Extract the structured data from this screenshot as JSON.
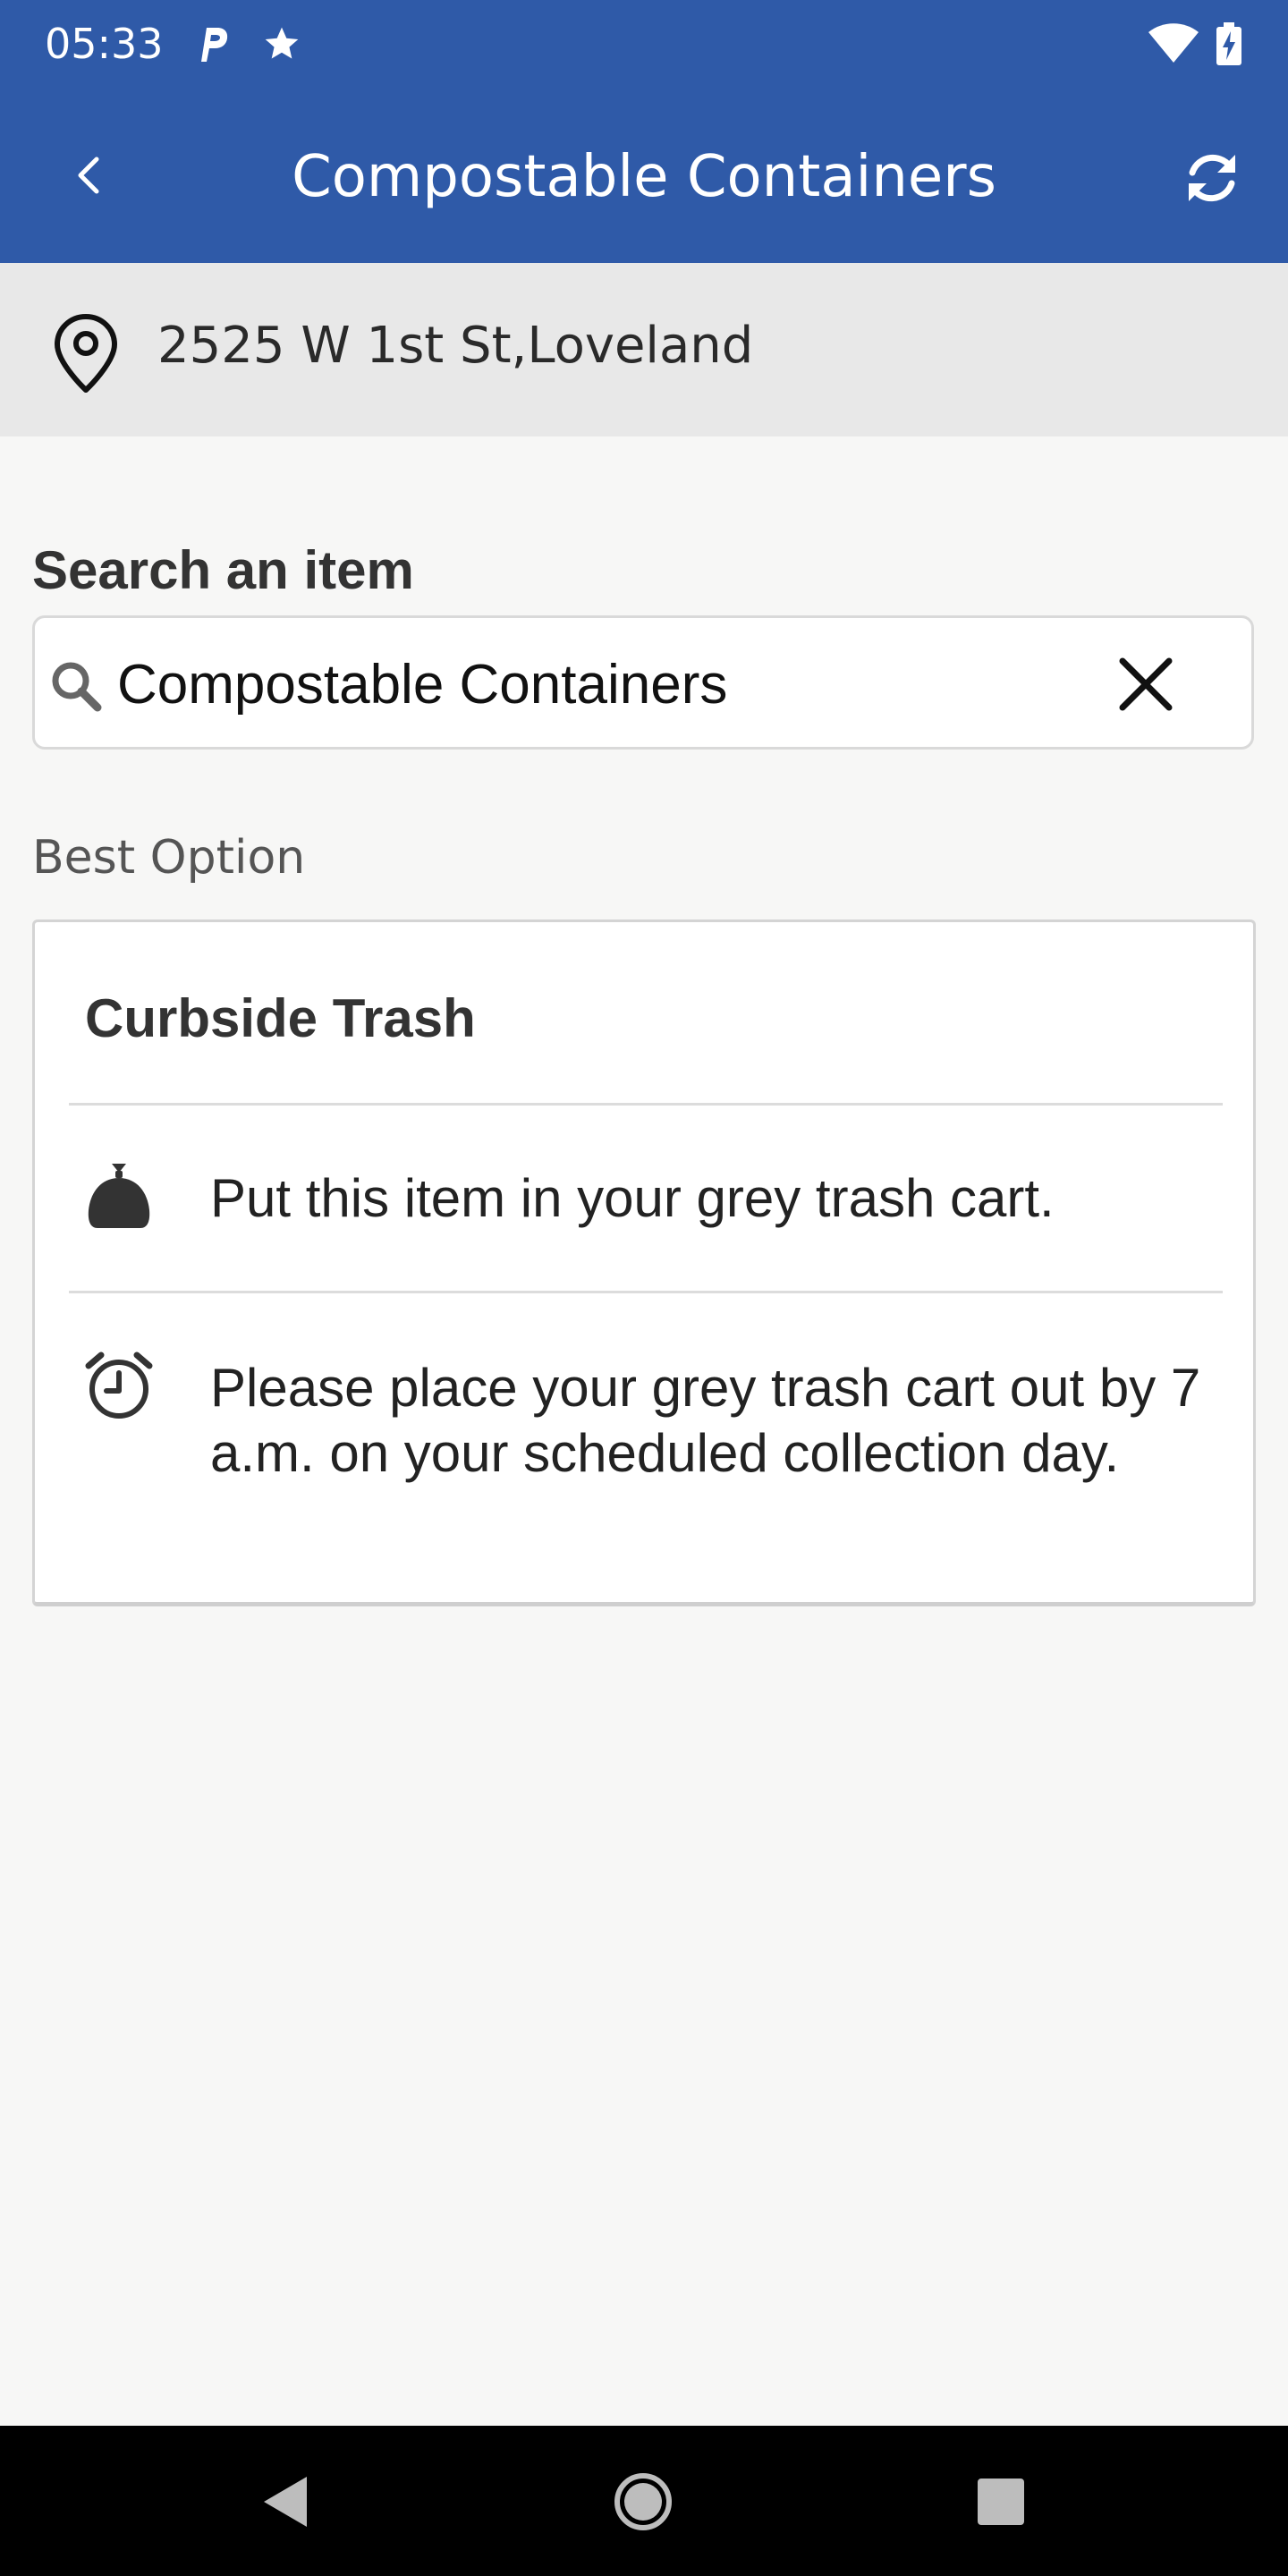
{
  "status_bar": {
    "time": "05:33",
    "icons": [
      "parking-icon",
      "star-icon",
      "wifi-icon",
      "battery-charging-icon"
    ]
  },
  "app_bar": {
    "title": "Compostable Containers",
    "back_icon": "chevron-left-icon",
    "refresh_icon": "refresh-icon"
  },
  "location": {
    "icon": "location-pin-icon",
    "address": "2525 W 1st St,Loveland"
  },
  "search": {
    "label": "Search an item",
    "value": "Compostable Containers",
    "icon": "search-icon",
    "clear_icon": "close-icon"
  },
  "best_option": {
    "label": "Best Option",
    "title": "Curbside Trash",
    "rows": [
      {
        "icon": "trash-bag-icon",
        "text": "Put this item in your grey trash cart."
      },
      {
        "icon": "alarm-clock-icon",
        "text": "Please place your grey trash cart out by 7 a.m. on your scheduled collection day."
      }
    ]
  },
  "nav_bar": {
    "icons": [
      "back-triangle-icon",
      "home-circle-icon",
      "recents-square-icon"
    ]
  },
  "colors": {
    "primary": "#2f5aa8",
    "location_bg": "#e8e8e8",
    "page_bg": "#f7f7f6"
  }
}
